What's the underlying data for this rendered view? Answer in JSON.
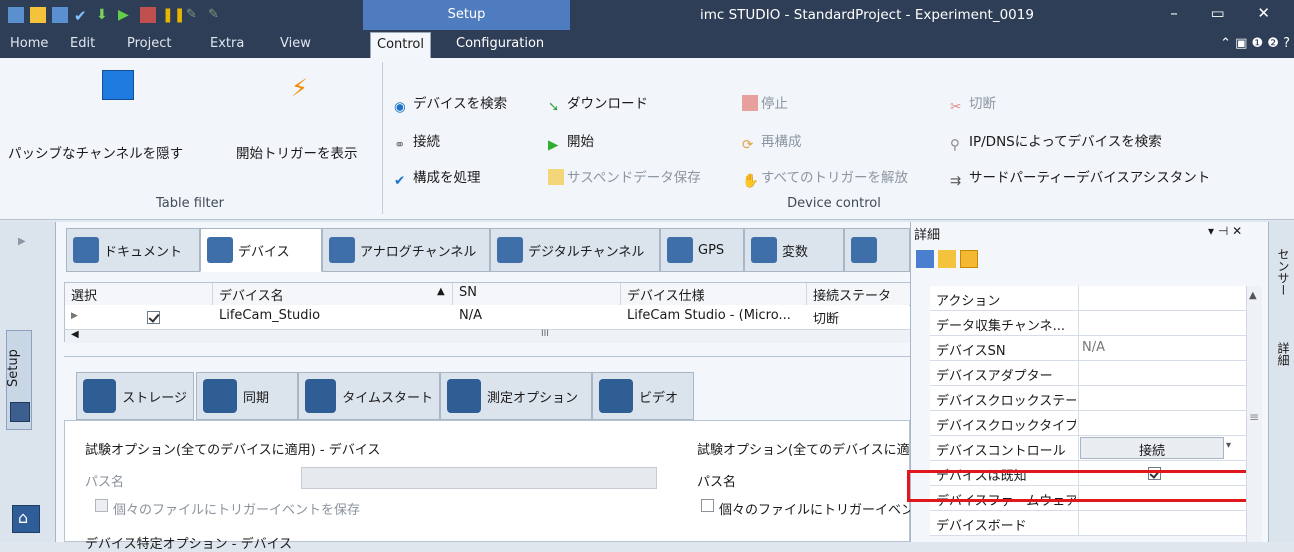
{
  "titlebar": {
    "context_tab": "Setup",
    "title": "imc STUDIO - StandardProject - Experiment_0019",
    "window_controls": "–  ▭  ✕"
  },
  "menubar": {
    "items": [
      "Home",
      "Edit",
      "Project",
      "Extra",
      "View"
    ],
    "tabs": [
      "Control",
      "Configuration"
    ]
  },
  "ribbon": {
    "table_filter": {
      "hide_passive": "パッシブなチャンネルを隠す",
      "show_trigger": "開始トリガーを表示",
      "group_label": "Table filter"
    },
    "device_control": {
      "search_devices": "デバイスを検索",
      "download": "ダウンロード",
      "stop": "停止",
      "disconnect": "切断",
      "connect": "接続",
      "start": "開始",
      "reconfigure": "再構成",
      "search_ip": "IP/DNSによってデバイスを検索",
      "process_config": "構成を処理",
      "save_suspend": "サスペンドデータ保存",
      "release_triggers": "すべてのトリガーを解放",
      "third_party": "サードパーティーデバイスアシスタント",
      "group_label": "Device control"
    }
  },
  "left_strip": {
    "setup_label": "Setup"
  },
  "top_tabs": [
    "ドキュメント",
    "デバイス",
    "アナログチャンネル",
    "デジタルチャンネル",
    "GPS",
    "変数"
  ],
  "grid": {
    "headers": [
      "選択",
      "デバイス名",
      "SN",
      "デバイス仕様",
      "接続ステータ"
    ],
    "rows": [
      {
        "name": "LifeCam_Studio",
        "sn": "N/A",
        "spec": "LifeCam Studio - (Micro...",
        "status": "切断"
      }
    ],
    "scroll_marker": "III"
  },
  "bottom_tabs": [
    "ストレージ",
    "同期",
    "タイムスタート",
    "測定オプション",
    "ビデオ"
  ],
  "lower": {
    "group1_title": "試験オプション(全てのデバイスに適用) - デバイス",
    "path_label": "パス名",
    "save_trigger": "個々のファイルにトリガーイベントを保存",
    "group2_title": "試験オプション(全てのデバイスに適",
    "path_label2": "パス名",
    "save_trigger2": "個々のファイルにトリガーイベン",
    "group3_title": "デバイス特定オプション - デバイス"
  },
  "details": {
    "title": "詳細",
    "pin": "▾ ⊣ ✕",
    "rows": [
      {
        "k": "アクション",
        "v": ""
      },
      {
        "k": "データ収集チャンネ...",
        "v": ""
      },
      {
        "k": "デバイスSN",
        "v": "N/A"
      },
      {
        "k": "デバイスアダプター",
        "v": ""
      },
      {
        "k": "デバイスクロックステート",
        "v": ""
      },
      {
        "k": "デバイスクロックタイプ",
        "v": ""
      },
      {
        "k": "デバイスコントロール",
        "v": "接続"
      },
      {
        "k": "デバイスは既知",
        "v": ""
      },
      {
        "k": "デバイスファームウェア",
        "v": ""
      },
      {
        "k": "デバイスボード",
        "v": ""
      }
    ]
  },
  "right_strip": {
    "tab1": "センサー",
    "tab2": "詳細"
  }
}
